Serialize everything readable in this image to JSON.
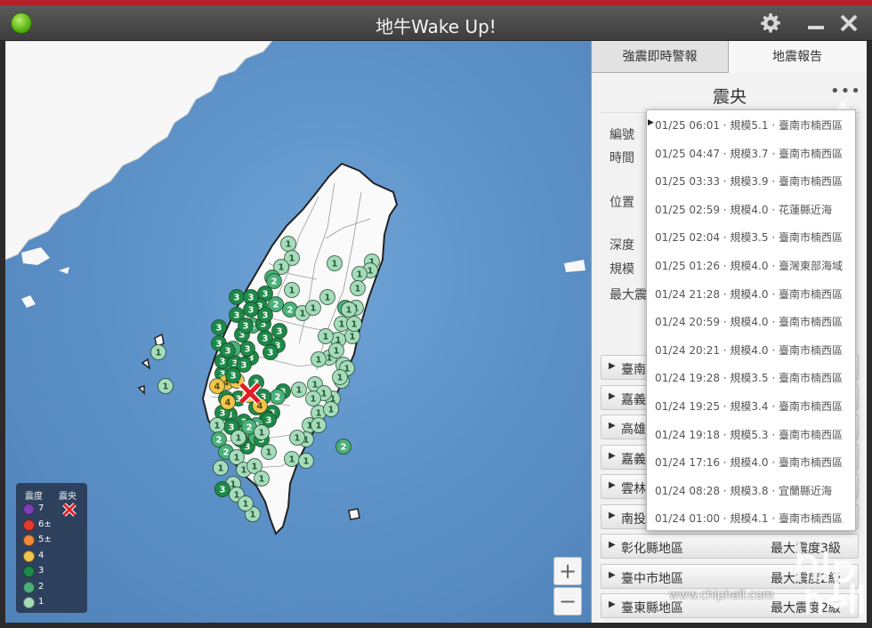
{
  "window": {
    "title": "地牛Wake Up!",
    "settings_icon": "gear-icon",
    "minimize_icon": "minimize-icon",
    "close_icon": "close-icon"
  },
  "legend": {
    "intensity_header": "震度",
    "epicenter_header": "震央",
    "levels": [
      {
        "label": "7",
        "color": "#7a3fb5"
      },
      {
        "label": "6±",
        "color": "#e23b2f"
      },
      {
        "label": "5±",
        "color": "#f08a3a"
      },
      {
        "label": "4",
        "color": "#f0c64a"
      },
      {
        "label": "3",
        "color": "#1e8a4a"
      },
      {
        "label": "2",
        "color": "#4bb07a"
      },
      {
        "label": "1",
        "color": "#a6dcbc"
      }
    ]
  },
  "map": {
    "zoom_in": "+",
    "zoom_out": "−",
    "stations": [
      {
        "v": "1",
        "c": "#a6dcbc"
      },
      {
        "v": "2",
        "c": "#4bb07a"
      },
      {
        "v": "3",
        "c": "#1e8a4a"
      },
      {
        "v": "4",
        "c": "#f0c64a"
      }
    ]
  },
  "panel": {
    "tabs": [
      "強震即時警報",
      "地震報告"
    ],
    "heading": "震央",
    "more": "•••",
    "info_labels": [
      "編號",
      "時間",
      "位置",
      "深度",
      "規模",
      "最大震"
    ],
    "regions": [
      {
        "name": "臺南",
        "max": ""
      },
      {
        "name": "嘉義",
        "max": ""
      },
      {
        "name": "高雄",
        "max": ""
      },
      {
        "name": "嘉義",
        "max": ""
      },
      {
        "name": "雲林",
        "max": ""
      },
      {
        "name": "南投",
        "max": ""
      },
      {
        "name": "彰化縣地區",
        "max": "最大震度3級"
      },
      {
        "name": "臺中市地區",
        "max": "最大震度2級"
      },
      {
        "name": "臺東縣地區",
        "max": "最大震度2級"
      }
    ]
  },
  "dropdown": {
    "items": [
      "01/25 06:01 · 規模5.1 · 臺南市楠西區",
      "01/25 04:47 · 規模3.7 · 臺南市楠西區",
      "01/25 03:33 · 規模3.9 · 臺南市楠西區",
      "01/25 02:59 · 規模4.0 · 花蓮縣近海",
      "01/25 02:04 · 規模3.5 · 臺南市楠西區",
      "01/25 01:26 · 規模4.0 · 臺灣東部海域",
      "01/24 21:28 · 規模4.0 · 臺南市楠西區",
      "01/24 20:59 · 規模4.0 · 臺南市楠西區",
      "01/24 20:21 · 規模4.0 · 臺南市楠西區",
      "01/24 19:28 · 規模3.5 · 臺南市楠西區",
      "01/24 19:25 · 規模3.4 · 臺南市楠西區",
      "01/24 19:18 · 規模5.3 · 臺南市楠西區",
      "01/24 17:16 · 規模4.0 · 臺南市楠西區",
      "01/24 08:28 · 規模3.8 · 宜蘭縣近海",
      "01/24 01:00 · 規模4.1 · 臺南市楠西區"
    ],
    "selected_index": 0
  },
  "watermark": {
    "url": "www.chiphell.com",
    "logo": "chiphell-logo"
  }
}
